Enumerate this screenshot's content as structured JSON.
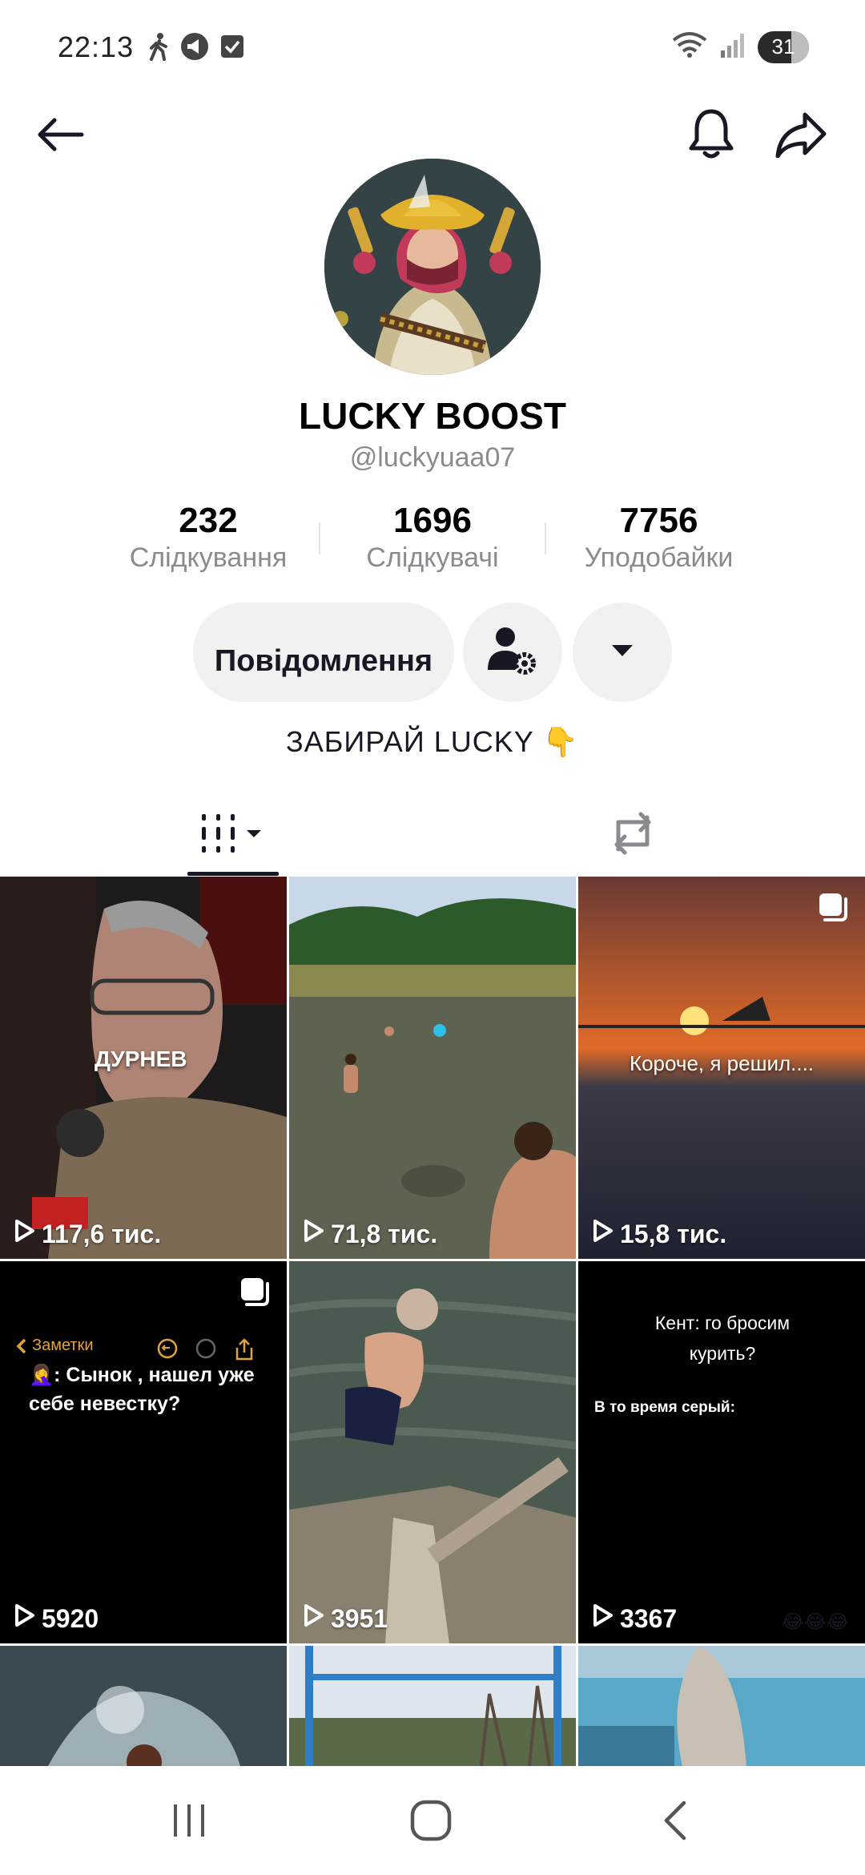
{
  "status_bar": {
    "time": "22:13",
    "battery": "31"
  },
  "profile": {
    "display_name": "LUCKY BOOST",
    "username": "@luckyuaa07",
    "bio": "ЗАБИРАЙ LUCKY 👇"
  },
  "stats": [
    {
      "value": "232",
      "label": "Слідкування"
    },
    {
      "value": "1696",
      "label": "Слідкувачі"
    },
    {
      "value": "7756",
      "label": "Уподобайки"
    }
  ],
  "actions": {
    "message_label": "Повідомлення"
  },
  "grid": {
    "tiles": [
      {
        "views": "117,6 тис.",
        "caption": "ДУРНЕВ"
      },
      {
        "views": "71,8 тис."
      },
      {
        "views": "15,8 тис.",
        "caption": "Короче, я решил...."
      },
      {
        "views": "5920",
        "notes_back": "Заметки",
        "caption": "🤦‍♀️: Сынок , нашел уже себе невестку?"
      },
      {
        "views": "3951"
      },
      {
        "views": "3367",
        "caption_top": "Кент: го бросим курить?",
        "caption_mid": "В то время серый:",
        "emoji": "😂😂😂"
      }
    ]
  },
  "colors": {
    "text_primary": "#161823",
    "text_secondary": "#8a8b91",
    "button_bg": "#f1f1f2"
  }
}
